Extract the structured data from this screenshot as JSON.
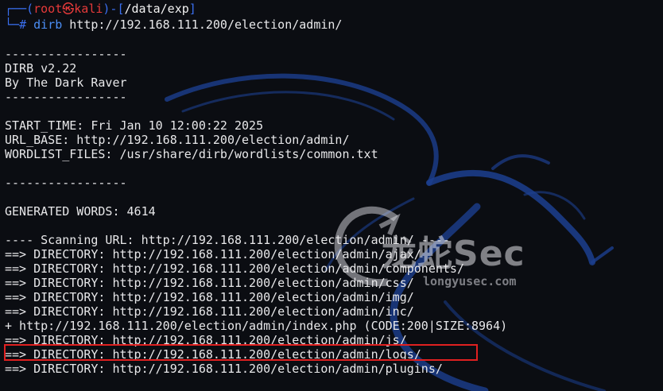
{
  "prompt": {
    "frame_left": "┌──(",
    "user": "root",
    "at_symbol": "㉿",
    "host": "kali",
    "frame_mid": ")-[",
    "path": "/data/exp",
    "frame_right": "]",
    "second_prefix": "└─",
    "hash": "#",
    "command": "dirb",
    "argument": "http://192.168.111.200/election/admin/"
  },
  "output": {
    "sep1": "-----------------",
    "version": "DIRB v2.22",
    "author": "By The Dark Raver",
    "sep2": "-----------------",
    "start_time": "START_TIME: Fri Jan 10 12:00:22 2025",
    "url_base": "URL_BASE: http://192.168.111.200/election/admin/",
    "wordlist": "WORDLIST_FILES: /usr/share/dirb/wordlists/common.txt",
    "sep3": "-----------------",
    "generated": "GENERATED WORDS: 4614",
    "scanning": "---- Scanning URL: http://192.168.111.200/election/admin/ ----",
    "results": [
      "==> DIRECTORY: http://192.168.111.200/election/admin/ajax/",
      "==> DIRECTORY: http://192.168.111.200/election/admin/components/",
      "==> DIRECTORY: http://192.168.111.200/election/admin/css/",
      "==> DIRECTORY: http://192.168.111.200/election/admin/img/",
      "==> DIRECTORY: http://192.168.111.200/election/admin/inc/",
      "+ http://192.168.111.200/election/admin/index.php (CODE:200|SIZE:8964)",
      "==> DIRECTORY: http://192.168.111.200/election/admin/js/",
      "==> DIRECTORY: http://192.168.111.200/election/admin/logs/",
      "==> DIRECTORY: http://192.168.111.200/election/admin/plugins/"
    ]
  },
  "watermark": {
    "brand": "龙蛇Sec",
    "site": "longyusec.com"
  },
  "colors": {
    "background": "#0b0d12",
    "prompt_blue": "#3a6ff0",
    "prompt_red": "#e63a3a",
    "highlight": "#e02020"
  }
}
